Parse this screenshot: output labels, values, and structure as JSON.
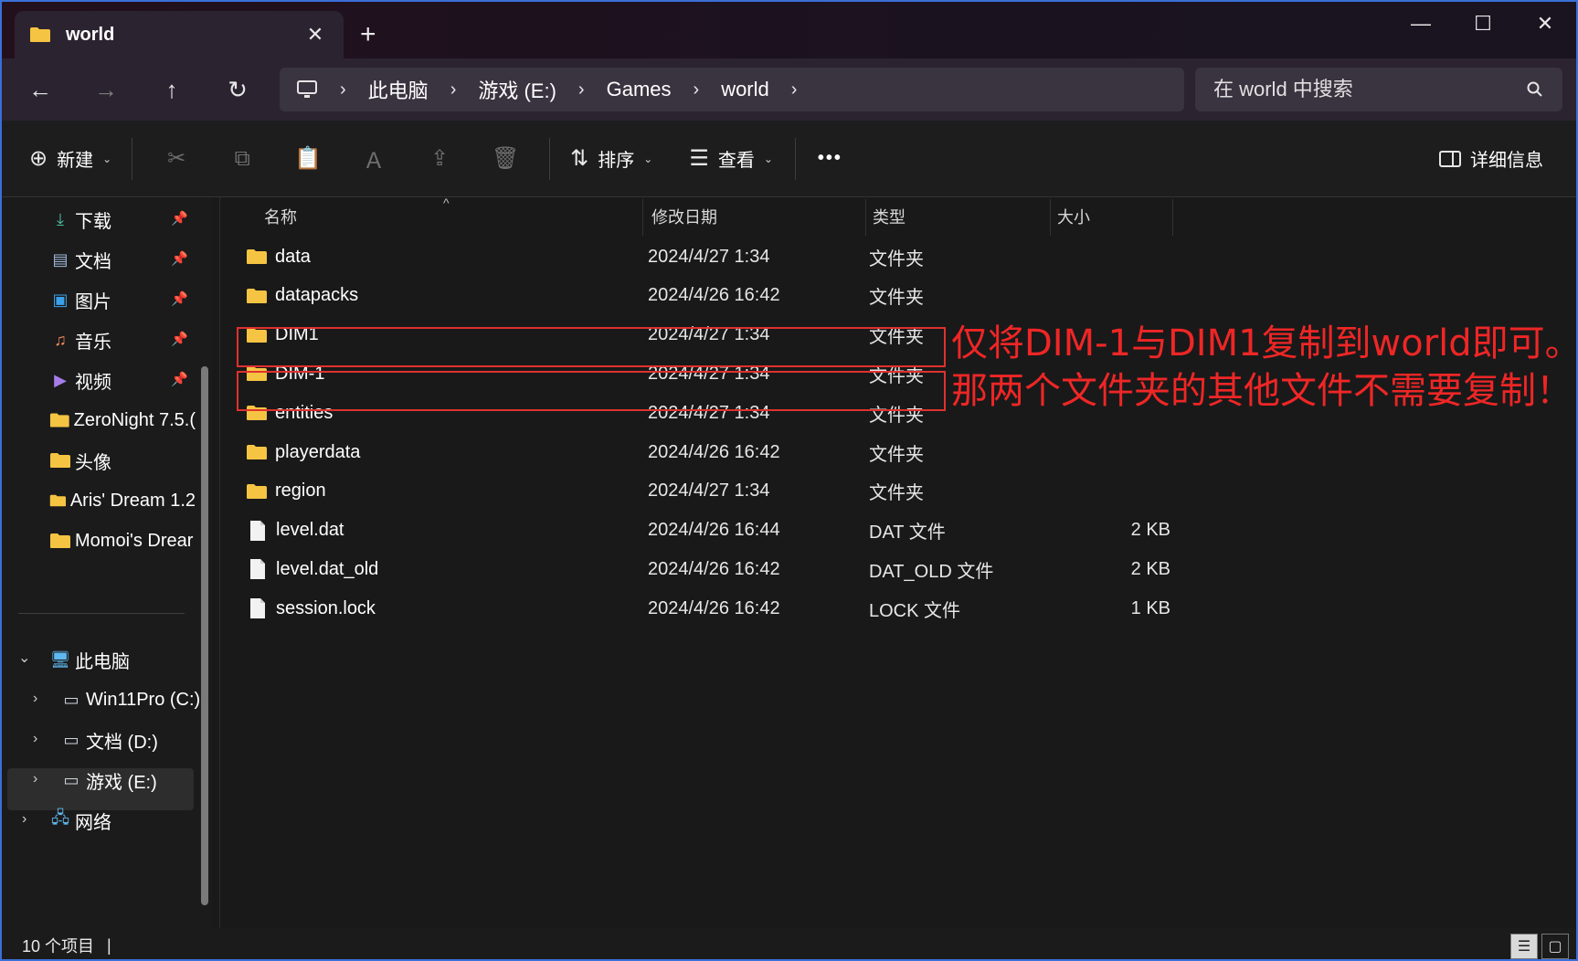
{
  "titlebar": {
    "tab_title": "world",
    "tab_close": "✕",
    "new_tab": "+",
    "minimize": "—",
    "maximize": "☐",
    "close": "✕"
  },
  "nav": {
    "back": "←",
    "forward": "→",
    "up": "↑",
    "refresh": "↻"
  },
  "breadcrumbs": [
    "此电脑",
    "游戏 (E:)",
    "Games",
    "world"
  ],
  "search": {
    "placeholder": "在 world 中搜索"
  },
  "commandbar": {
    "new_label": "新建",
    "sort_label": "排序",
    "view_label": "查看",
    "more_label": "•••",
    "details_label": "详细信息"
  },
  "sidebar": {
    "quick_access": [
      {
        "label": "下载",
        "icon": "download-icon",
        "pinned": true
      },
      {
        "label": "文档",
        "icon": "documents-icon",
        "pinned": true
      },
      {
        "label": "图片",
        "icon": "pictures-icon",
        "pinned": true
      },
      {
        "label": "音乐",
        "icon": "music-icon",
        "pinned": true
      },
      {
        "label": "视频",
        "icon": "videos-icon",
        "pinned": true
      },
      {
        "label": "ZeroNight 7.5.(",
        "icon": "folder-icon",
        "pinned": false
      },
      {
        "label": "头像",
        "icon": "folder-icon",
        "pinned": false
      },
      {
        "label": "Aris' Dream 1.2",
        "icon": "folder-icon",
        "pinned": false
      },
      {
        "label": "Momoi's Drear",
        "icon": "folder-icon",
        "pinned": false
      }
    ],
    "this_pc": "此电脑",
    "drives": [
      {
        "label": "Win11Pro (C:)",
        "icon": "windows-drive-icon"
      },
      {
        "label": "文档 (D:)",
        "icon": "drive-icon"
      },
      {
        "label": "游戏 (E:)",
        "icon": "drive-icon"
      }
    ],
    "network": "网络"
  },
  "columns": {
    "name": "名称",
    "modified": "修改日期",
    "type": "类型",
    "size": "大小"
  },
  "files": [
    {
      "name": "data",
      "modified": "2024/4/27 1:34",
      "type": "文件夹",
      "size": "",
      "kind": "folder"
    },
    {
      "name": "datapacks",
      "modified": "2024/4/26 16:42",
      "type": "文件夹",
      "size": "",
      "kind": "folder"
    },
    {
      "name": "DIM1",
      "modified": "2024/4/27 1:34",
      "type": "文件夹",
      "size": "",
      "kind": "folder"
    },
    {
      "name": "DIM-1",
      "modified": "2024/4/27 1:34",
      "type": "文件夹",
      "size": "",
      "kind": "folder"
    },
    {
      "name": "entities",
      "modified": "2024/4/27 1:34",
      "type": "文件夹",
      "size": "",
      "kind": "folder"
    },
    {
      "name": "playerdata",
      "modified": "2024/4/26 16:42",
      "type": "文件夹",
      "size": "",
      "kind": "folder"
    },
    {
      "name": "region",
      "modified": "2024/4/27 1:34",
      "type": "文件夹",
      "size": "",
      "kind": "folder"
    },
    {
      "name": "level.dat",
      "modified": "2024/4/26 16:44",
      "type": "DAT 文件",
      "size": "2 KB",
      "kind": "file"
    },
    {
      "name": "level.dat_old",
      "modified": "2024/4/26 16:42",
      "type": "DAT_OLD 文件",
      "size": "2 KB",
      "kind": "file"
    },
    {
      "name": "session.lock",
      "modified": "2024/4/26 16:42",
      "type": "LOCK 文件",
      "size": "1 KB",
      "kind": "file"
    }
  ],
  "annotation": {
    "line1": "仅将DIM-1与DIM1复制到world即可。",
    "line2": "那两个文件夹的其他文件不需要复制！",
    "color": "#e0312e"
  },
  "statusbar": {
    "item_count": "10 个项目",
    "separator": "|"
  },
  "colors": {
    "folder": "#f6c443",
    "accent_border": "#3a6fd8"
  }
}
